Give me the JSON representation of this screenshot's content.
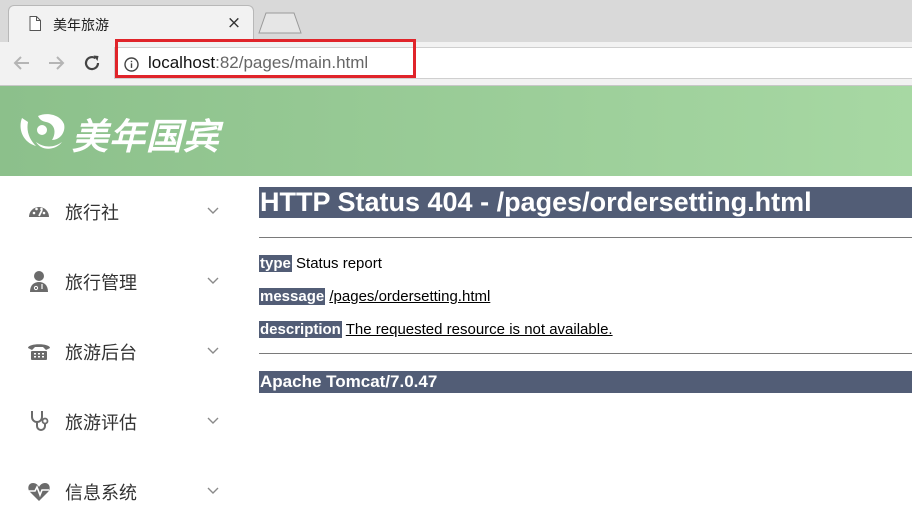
{
  "browser": {
    "tab": {
      "title": "美年旅游",
      "close_glyph": "×"
    },
    "address": {
      "host": "localhost",
      "rest": ":82/pages/main.html"
    }
  },
  "app": {
    "brand": "美年国宾",
    "sidebar": {
      "items": [
        {
          "label": "旅行社",
          "icon": "dashboard-icon"
        },
        {
          "label": "旅行管理",
          "icon": "user-doctor-icon"
        },
        {
          "label": "旅游后台",
          "icon": "phone-icon"
        },
        {
          "label": "旅游评估",
          "icon": "stethoscope-icon"
        },
        {
          "label": "信息系统",
          "icon": "heartbeat-icon"
        }
      ]
    }
  },
  "error_page": {
    "heading": "HTTP Status 404 - /pages/ordersetting.html",
    "type_label": "type",
    "type_value": "Status report",
    "message_label": "message",
    "message_value": "/pages/ordersetting.html",
    "description_label": "description",
    "description_value": "The requested resource is not available.",
    "server": "Apache Tomcat/7.0.47"
  },
  "colors": {
    "error_bar": "#525d76",
    "header_gradient_start": "#8cc08b",
    "header_gradient_end": "#a7d8a3",
    "highlight_box": "#e0242a"
  }
}
